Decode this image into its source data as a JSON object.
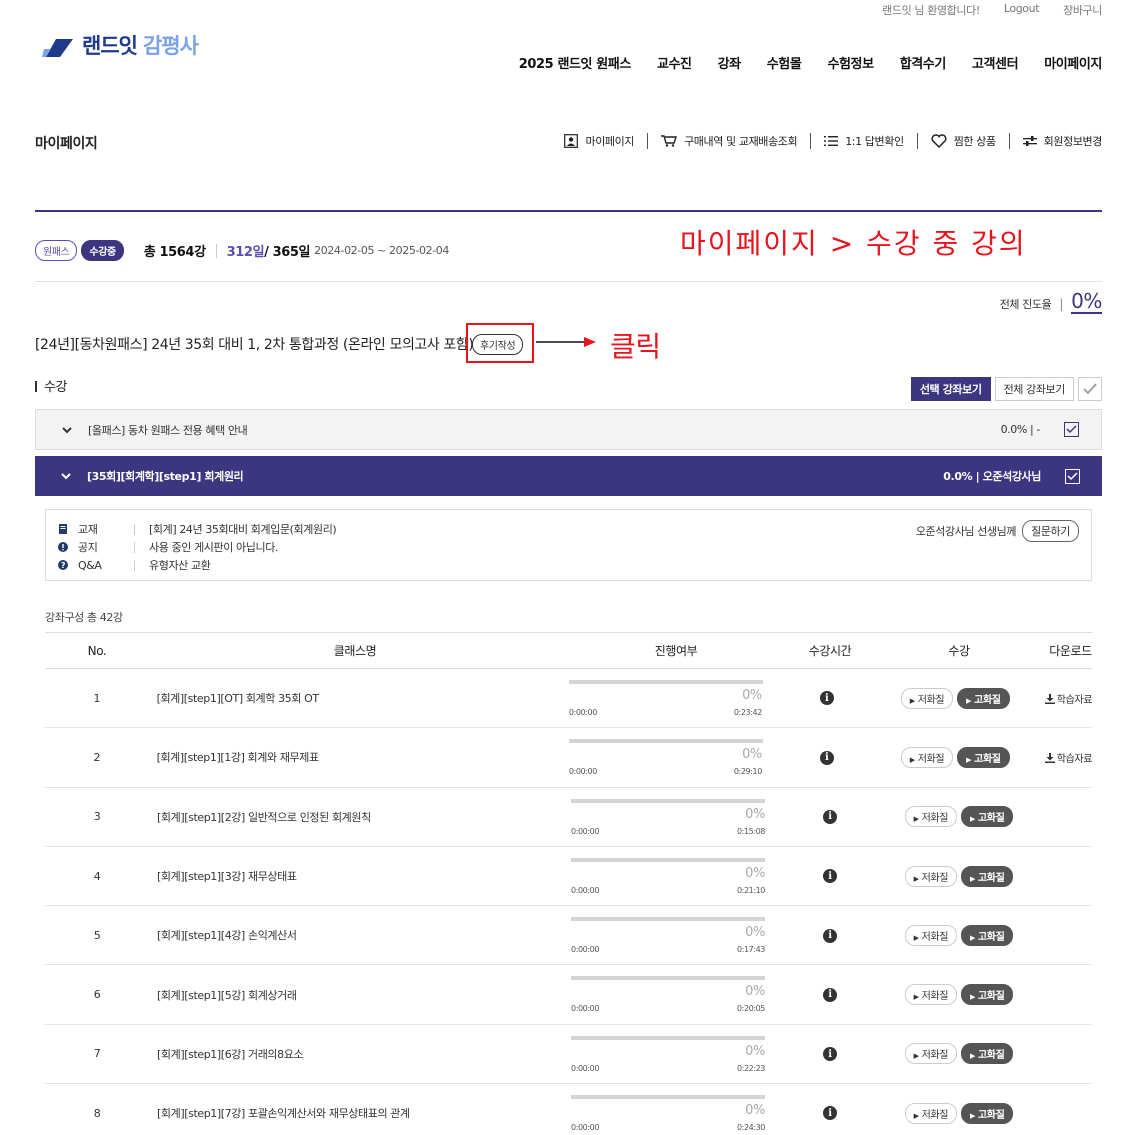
{
  "util": {
    "welcome": "랜드잇 님 환영합니다!",
    "logout": "Logout",
    "cart": "장바구니"
  },
  "logo": {
    "brand": "랜드잇",
    "sub": "감평사"
  },
  "gnb": [
    "2025 랜드잇 원패스",
    "교수진",
    "강좌",
    "수험몰",
    "수험정보",
    "합격수기",
    "고객센터",
    "마이페이지"
  ],
  "page_title": "마이페이지",
  "subnav": [
    {
      "icon": "user-box-icon",
      "label": "마이페이지"
    },
    {
      "icon": "cart-icon",
      "label": "구매내역 및 교재배송조회"
    },
    {
      "icon": "list-icon",
      "label": "1:1 답변확인"
    },
    {
      "icon": "heart-icon",
      "label": "찜한 상품"
    },
    {
      "icon": "sliders-icon",
      "label": "회원정보변경"
    }
  ],
  "pass": {
    "badge1": "원패스",
    "badge2": "수강중",
    "total": "총 1564강",
    "days_used": "312일",
    "days_total": " / 365일",
    "dates": "2024-02-05 ~ 2025-02-04"
  },
  "annotation_top": "마이페이지 > 수강 중 강의",
  "annotation_click": "클릭",
  "progress": {
    "label": "전체 진도율",
    "sep": "|",
    "value": "0%"
  },
  "course": {
    "title": "[24년][동차원패스] 24년 35회 대비 1, 2차 통합과정 (온라인 모의고사 포함)",
    "review": "후기작성"
  },
  "section_label": "수강",
  "view": {
    "selected": "선택 강좌보기",
    "all": "전체 강좌보기"
  },
  "accordion": [
    {
      "title": "[올패스] 동차 원패스 전용 혜택 안내",
      "meta": "0.0% | -"
    },
    {
      "title": "[35회][회계학][step1] 회계원리",
      "meta": "0.0% | 오준석강사님"
    }
  ],
  "info": {
    "rows": [
      {
        "key": "교재",
        "val": "[회계] 24년 35회대비 회계입문(회계원리)"
      },
      {
        "key": "공지",
        "val": "사용 중인 게시판이 아닙니다."
      },
      {
        "key": "Q&A",
        "val": "유형자산 교환"
      }
    ],
    "teacher": "오준석강사님 선생님께",
    "ask": "질문하기"
  },
  "compose": "강좌구성 총 42강",
  "table": {
    "headers": [
      "No.",
      "클래스명",
      "진행여부",
      "수강시간",
      "수강",
      "다운로드"
    ],
    "low": "저화질",
    "high": "고화질",
    "download": "학습자료",
    "rows": [
      {
        "no": "1",
        "name": "[회계][step1][OT] 회계학 35회 OT",
        "pct": "0%",
        "cur": "0:00:00",
        "dur": "0:23:42",
        "progress": 0,
        "dl": true
      },
      {
        "no": "2",
        "name": "[회계][step1][1강] 회계와 재무제표",
        "pct": "0%",
        "cur": "0:00:00",
        "dur": "0:29:10",
        "progress": 0,
        "dl": true
      },
      {
        "no": "3",
        "name": "[회계][step1][2강] 일반적으로 인정된 회계원칙",
        "pct": "0%",
        "cur": "0:00:00",
        "dur": "0:15:08",
        "progress": 0,
        "dl": false
      },
      {
        "no": "4",
        "name": "[회계][step1][3강] 재무상태표",
        "pct": "0%",
        "cur": "0:00:00",
        "dur": "0:21:10",
        "progress": 0,
        "dl": false
      },
      {
        "no": "5",
        "name": "[회계][step1][4강] 손익계산서",
        "pct": "0%",
        "cur": "0:00:00",
        "dur": "0:17:43",
        "progress": 0,
        "dl": false
      },
      {
        "no": "6",
        "name": "[회계][step1][5강] 회계상거래",
        "pct": "0%",
        "cur": "0:00:00",
        "dur": "0:20:05",
        "progress": 0,
        "dl": false
      },
      {
        "no": "7",
        "name": "[회계][step1][6강] 거래의8요소",
        "pct": "0%",
        "cur": "0:00:00",
        "dur": "0:22:23",
        "progress": 0,
        "dl": false
      },
      {
        "no": "8",
        "name": "[회계][step1][7강] 포괄손익계산서와 재무상태표의 관계",
        "pct": "0%",
        "cur": "0:00:00",
        "dur": "0:24:30",
        "progress": 0,
        "dl": false
      }
    ]
  },
  "colors": {
    "brand": "#3c3580",
    "annotation": "#e6141e",
    "logo_dark": "#1f3a8a",
    "logo_light": "#7aa3e5"
  }
}
